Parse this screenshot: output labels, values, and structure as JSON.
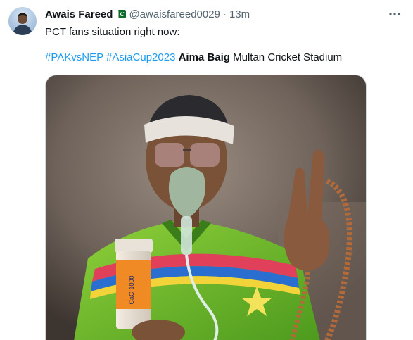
{
  "tweet": {
    "author_name": "Awais Fareed",
    "handle": "@awaisfareed0029",
    "separator": "·",
    "time": "13m",
    "more_icon": "more-horizontal-icon",
    "line1": "PCT fans situation right now:",
    "hashtag1": "#PAKvsNEP",
    "hashtag2": "#AsiaCup2023",
    "mention_bold": "Aima Baig",
    "location_text": "Multan Cricket Stadium"
  },
  "photo": {
    "subject": "fan-in-oxygen-mask-photo",
    "bottle_label": "CaC-1000"
  },
  "colors": {
    "link": "#1d9bf0",
    "secondary_text": "#536471",
    "primary_text": "#0f1419"
  }
}
